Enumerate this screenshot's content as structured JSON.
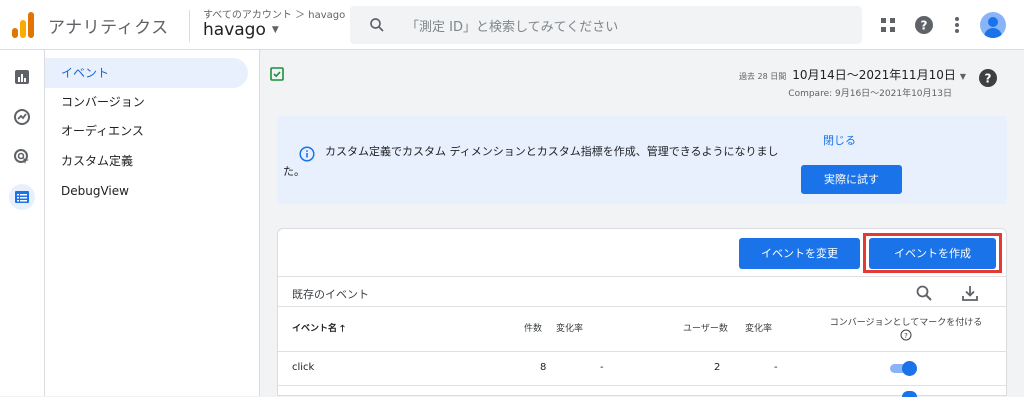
{
  "header": {
    "app_title": "アナリティクス",
    "breadcrumb": "すべてのアカウント ＞ havago",
    "account": "havago",
    "search_placeholder": "「測定 ID」と検索してみてください"
  },
  "sidebar": {
    "items": [
      {
        "label": "イベント",
        "active": true
      },
      {
        "label": "コンバージョン"
      },
      {
        "label": "オーディエンス"
      },
      {
        "label": "カスタム定義"
      },
      {
        "label": "DebugView"
      }
    ]
  },
  "date": {
    "label": "過去 28 日間",
    "range": "10月14日～2021年11月10日",
    "compare": "Compare: 9月16日～2021年10月13日"
  },
  "banner": {
    "message": "カスタム定義でカスタム ディメンションとカスタム指標を作成、管理できるようになりました。",
    "close_label": "閉じる",
    "try_label": "実際に試す"
  },
  "events": {
    "modify_button": "イベントを変更",
    "create_button": "イベントを作成",
    "section_title": "既存のイベント",
    "columns": {
      "name": "イベント名",
      "count": "件数",
      "count_change": "変化率",
      "users": "ユーザー数",
      "users_change": "変化率",
      "conversion": "コンバージョンとしてマークを付ける"
    },
    "rows": [
      {
        "name": "click",
        "count": "8",
        "count_change": "-",
        "users": "2",
        "users_change": "-",
        "conversion": true
      }
    ]
  },
  "colors": {
    "brand_blue": "#1a73e8",
    "highlight_red": "#e53935",
    "banner_bg": "#e8f0fe"
  }
}
